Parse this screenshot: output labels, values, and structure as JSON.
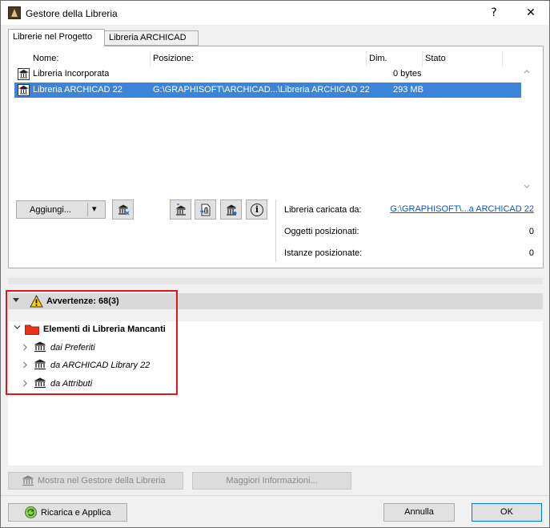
{
  "window": {
    "title": "Gestore della Libreria",
    "help_label": "?",
    "close_label": "✕"
  },
  "tabs": [
    {
      "label": "Librerie nel Progetto",
      "active": true
    },
    {
      "label": "Libreria ARCHICAD 22",
      "active": false
    }
  ],
  "library_table": {
    "columns": [
      "Nome:",
      "Posizione:",
      "Dim.",
      "Stato"
    ],
    "rows": [
      {
        "name": "Libreria Incorporata",
        "path": "",
        "size": "0 bytes",
        "status": "",
        "selected": false
      },
      {
        "name": "Libreria ARCHICAD 22",
        "path": "G:\\GRAPHISOFT\\ARCHICAD...\\Libreria ARCHICAD 22",
        "size": "293 MB",
        "status": "",
        "selected": true
      }
    ]
  },
  "toolbar": {
    "add_label": "Aggiungi...",
    "dropdown_arrow": "▾",
    "info_icon": "i"
  },
  "info": {
    "loaded_from_label": "Libreria caricata da:",
    "loaded_from_value": "G:\\GRAPHISOFT\\...a ARCHICAD 22",
    "placed_objects_label": "Oggetti posizionati:",
    "placed_objects_value": "0",
    "placed_instances_label": "Istanze posizionate:",
    "placed_instances_value": "0"
  },
  "warnings": {
    "header": "Avvertenze: 68(3)",
    "tree": {
      "root": "Elementi di Libreria Mancanti",
      "children": [
        "dai Preferiti",
        "da ARCHICAD Library 22",
        "da Attributi"
      ]
    }
  },
  "bottom": {
    "show_in_manager_label": "Mostra nel Gestore della Libreria",
    "more_info_label": "Maggiori Informazioni...",
    "reload_apply_label": "Ricarica e Applica",
    "cancel_label": "Annulla",
    "ok_label": "OK"
  },
  "colors": {
    "selection": "#3b84d8",
    "link": "#0b55c4",
    "highlight_box": "#e0171c",
    "folder": "#e8301c"
  }
}
